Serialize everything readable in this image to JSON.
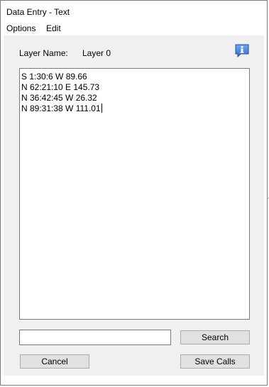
{
  "window": {
    "title": "Data Entry - Text"
  },
  "menu": {
    "items": [
      "Options",
      "Edit"
    ]
  },
  "layer": {
    "label": "Layer Name:",
    "value": "Layer 0"
  },
  "info_icon": "info-bubble-icon",
  "text_entry": {
    "lines": [
      "S 1:30:6 W 89.66",
      "N 62:21:10 E 145.73",
      "N 36:42:45 W 26.32",
      "N 89:31:38 W 111.01"
    ]
  },
  "search": {
    "value": "",
    "placeholder": "",
    "button_label": "Search"
  },
  "buttons": {
    "cancel_label": "Cancel",
    "save_label": "Save Calls"
  },
  "colors": {
    "dialog_background": "#f0f0f0",
    "button_face": "#e1e1e1",
    "info_icon_blue": "#2f6fd0"
  }
}
